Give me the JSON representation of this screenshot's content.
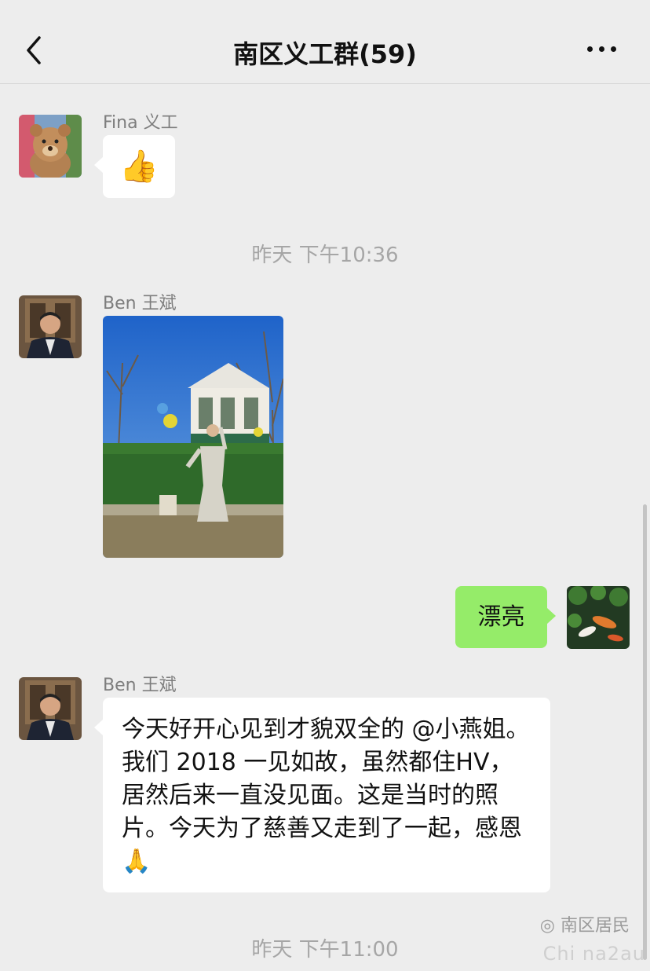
{
  "header": {
    "title": "南区义工群(59)",
    "back_icon": "chevron-left-icon",
    "more_icon": "ellipsis-icon"
  },
  "messages": {
    "m1": {
      "sender": "Fina 义工",
      "content": "👍",
      "avatar_icon": "teddy-bear-avatar"
    },
    "ts1": "昨天 下午10:36",
    "m2": {
      "sender": "Ben 王斌",
      "content_type": "image",
      "image_desc": "photo",
      "avatar_icon": "man-portrait-avatar"
    },
    "m3": {
      "content": "漂亮",
      "avatar_icon": "koi-pond-avatar"
    },
    "m4": {
      "sender": "Ben 王斌",
      "content": "今天好开心见到才貌双全的 @小燕姐。我们 2018 一见如故，虽然都住HV，居然后来一直没见面。这是当时的照片。今天为了慈善又走到了一起，感恩🙏"
    },
    "ts2": "昨天 下午11:00"
  },
  "watermark": {
    "label": "南区居民",
    "site": "Chi na2au"
  },
  "colors": {
    "background": "#ededed",
    "bubble_incoming": "#ffffff",
    "bubble_outgoing": "#95ec69"
  }
}
